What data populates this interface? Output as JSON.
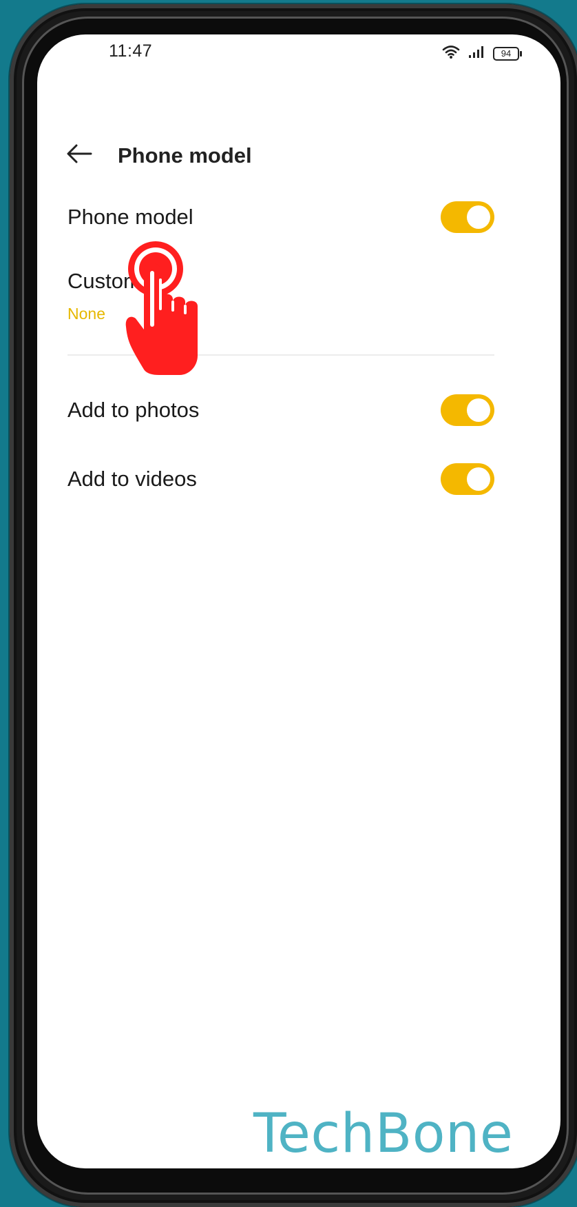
{
  "status_bar": {
    "time": "11:47",
    "battery_level": "94",
    "icons": [
      "wifi-icon",
      "signal-icon",
      "battery-icon"
    ]
  },
  "header": {
    "back_icon": "arrow-left-icon",
    "title": "Phone model"
  },
  "settings": {
    "phone_model": {
      "label": "Phone model",
      "enabled": true
    },
    "custom": {
      "label": "Custom",
      "value": "None"
    },
    "add_to_photos": {
      "label": "Add to photos",
      "enabled": true
    },
    "add_to_videos": {
      "label": "Add to videos",
      "enabled": true
    }
  },
  "colors": {
    "accent": "#f4b800",
    "accent_text": "#e6b800",
    "background": "#137a8c",
    "pointer": "#ff1f1f"
  },
  "overlay": {
    "pointer_icon": "tap-hand-icon"
  },
  "watermark": {
    "text": "TechBone"
  }
}
